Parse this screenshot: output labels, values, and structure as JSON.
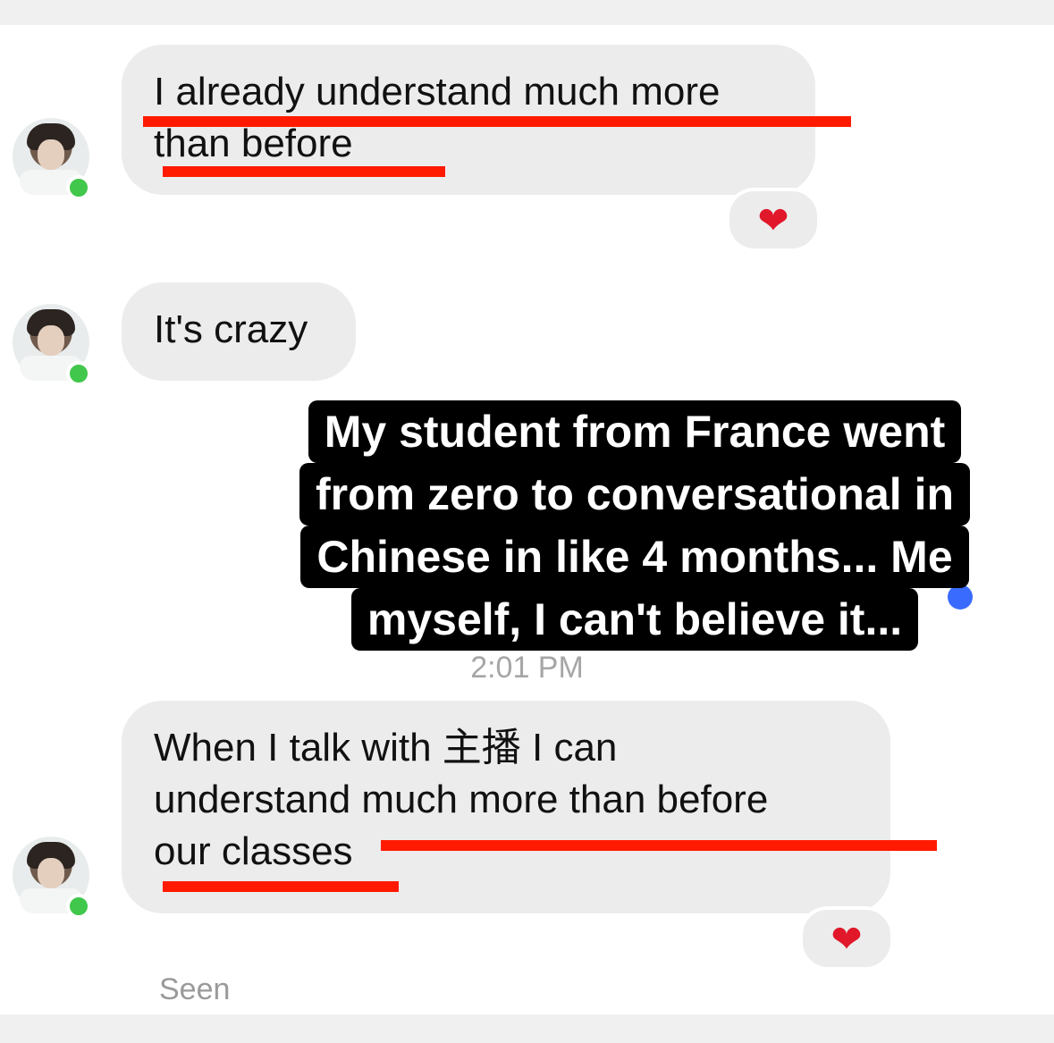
{
  "messages": [
    {
      "text": "I already understand much more\nthan before",
      "reaction": "❤"
    },
    {
      "text": "It's crazy"
    },
    {
      "text": "When I talk with 主播 I can\nunderstand much more than before\nour classes",
      "reaction": "❤"
    }
  ],
  "caption": {
    "line1": "My student from France went",
    "line2": "from zero to conversational in",
    "line3": "Chinese in like 4 months... Me",
    "line4": "myself, I can't believe it..."
  },
  "timestamp": "2:01 PM",
  "status": "Seen",
  "colors": {
    "bubble": "#ececec",
    "underline": "#ff1a00",
    "online": "#41c74b",
    "caption_bg": "#000000"
  },
  "icons": {
    "reaction": "heart-icon",
    "presence": "online-dot-icon"
  }
}
